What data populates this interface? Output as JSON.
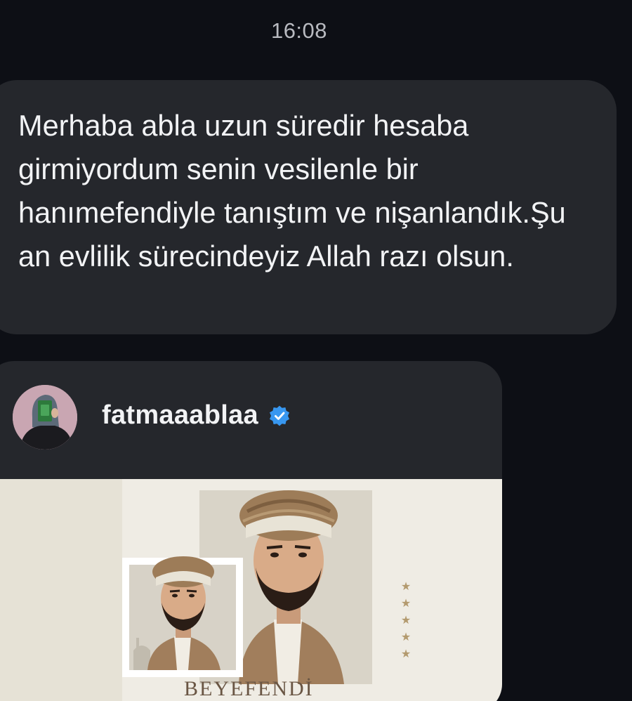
{
  "chat": {
    "timestamp": "16:08",
    "message": {
      "text": "Merhaba abla uzun süredir hesaba girmiyordum senin vesilenle bir hanımefendiyle tanıştım ve nişanlandık.Şu an evlilik sürecindeyiz Allah razı olsun."
    },
    "shared_post": {
      "username": "fatmaaablaa",
      "verified": true,
      "avatar_icon": "hijab-woman-avatar-icon",
      "verified_icon": "verified-badge-icon",
      "image_caption": "BEYEFENDİ",
      "stars": [
        "★",
        "★",
        "★",
        "★",
        "★"
      ]
    }
  },
  "colors": {
    "background": "#0d0f15",
    "bubble": "#25272c",
    "text": "#f2f3f5",
    "timestamp": "#b8bac0",
    "verified_blue": "#3897f0"
  }
}
